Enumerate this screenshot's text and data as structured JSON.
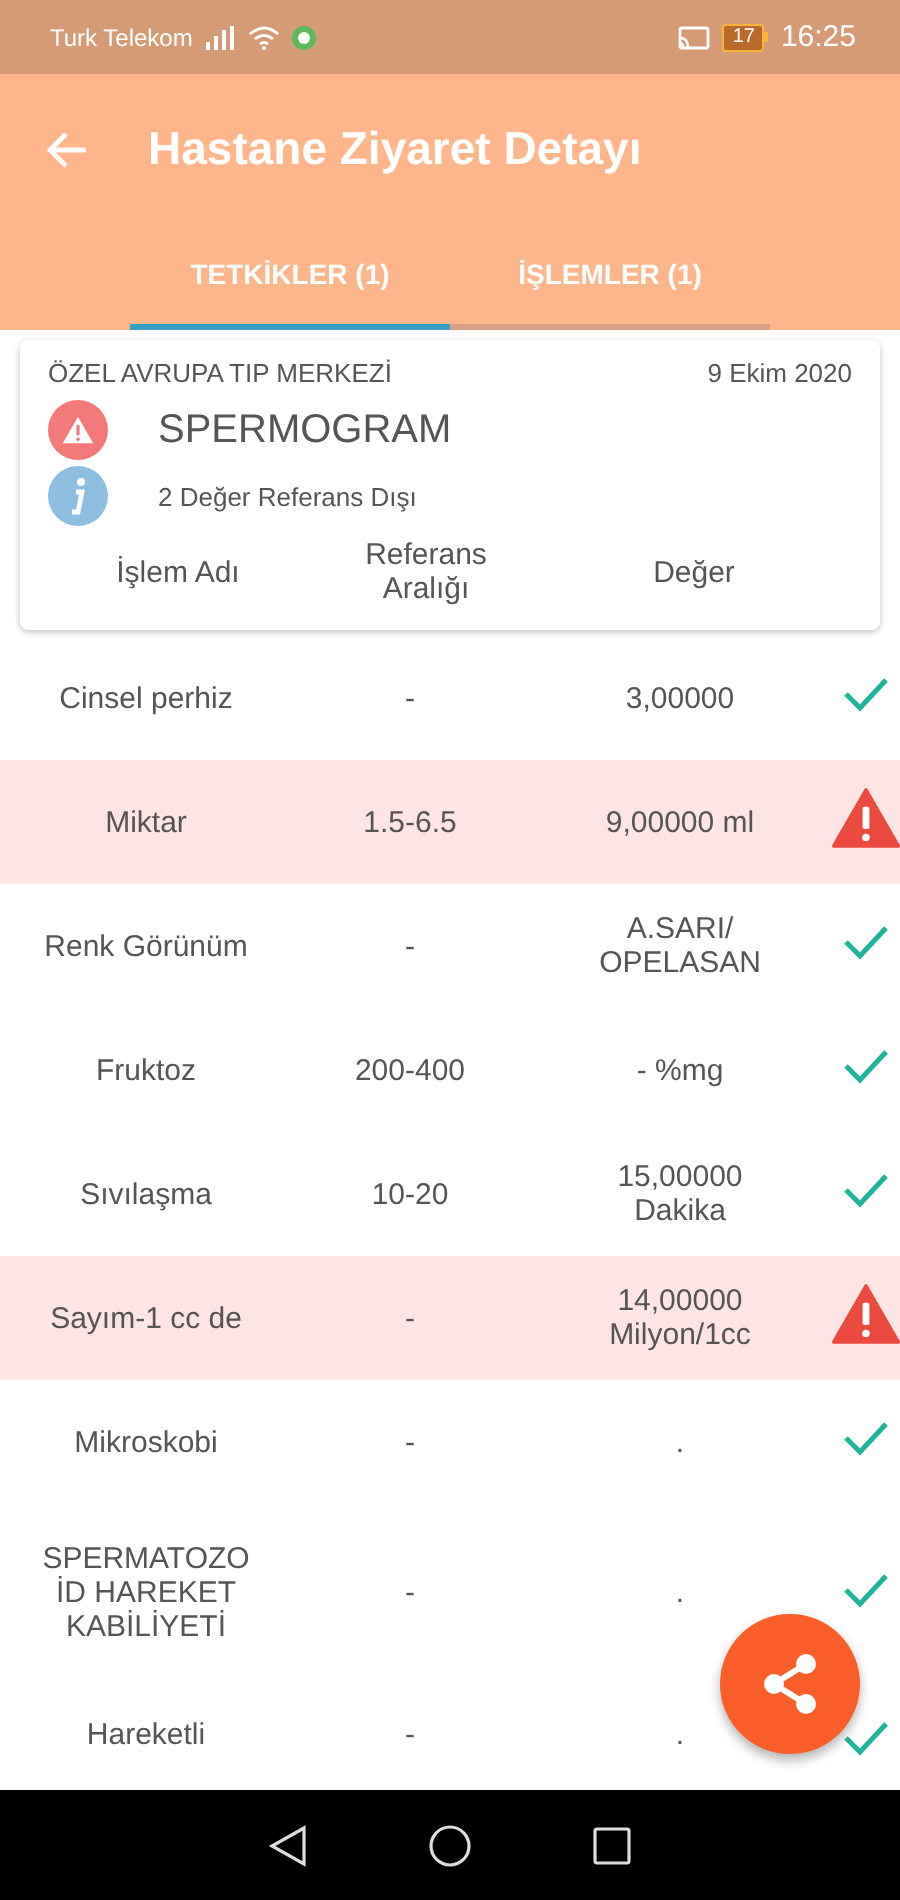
{
  "status_bar": {
    "carrier": "Turk Telekom",
    "battery": "17",
    "time": "16:25"
  },
  "app_bar": {
    "title": "Hastane Ziyaret Detayı"
  },
  "tabs": [
    {
      "label": "TETKİKLER (1)",
      "selected": true
    },
    {
      "label": "İŞLEMLER (1)",
      "selected": false
    }
  ],
  "card": {
    "facility": "ÖZEL AVRUPA TIP MERKEZİ",
    "date": "9 Ekim 2020",
    "test_name": "SPERMOGRAM",
    "info": "2 Değer Referans Dışı",
    "columns": [
      "İşlem Adı",
      "Referans Aralığı",
      "Değer"
    ]
  },
  "rows": [
    {
      "name": "Cinsel perhiz",
      "reference": "-",
      "value": "3,00000",
      "out_of_range": false
    },
    {
      "name": "Miktar",
      "reference": "1.5-6.5",
      "value": "9,00000 ml",
      "out_of_range": true
    },
    {
      "name": "Renk  Görünüm",
      "reference": "-",
      "value": "A.SARI/ OPELASAN",
      "out_of_range": false
    },
    {
      "name": "Fruktoz",
      "reference": "200-400",
      "value": "- %mg",
      "out_of_range": false
    },
    {
      "name": "Sıvılaşma",
      "reference": "10-20",
      "value": "15,00000 Dakika",
      "out_of_range": false
    },
    {
      "name": "Sayım-1 cc de",
      "reference": "-",
      "value": "14,00000 Milyon/1cc",
      "out_of_range": true
    },
    {
      "name": "Mikroskobi",
      "reference": "-",
      "value": ".",
      "out_of_range": false
    },
    {
      "name": "SPERMATOZO İD HAREKET KABİLİYETİ",
      "reference": "-",
      "value": ".",
      "out_of_range": false
    },
    {
      "name": "Hareketli",
      "reference": "-",
      "value": ".",
      "out_of_range": false
    }
  ]
}
